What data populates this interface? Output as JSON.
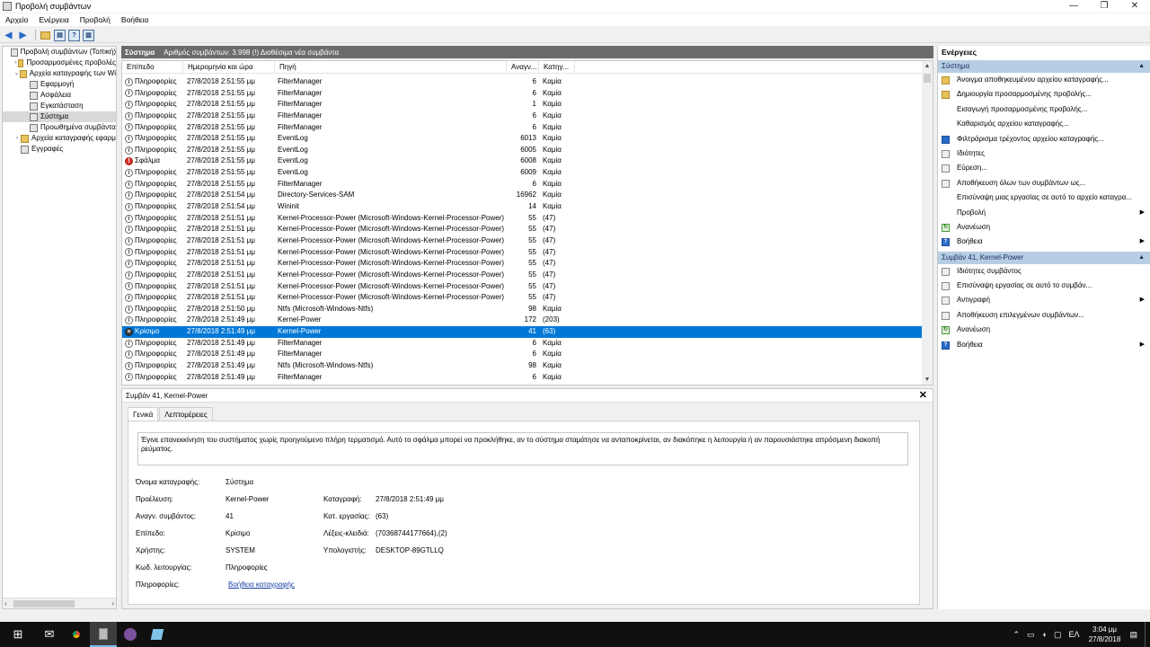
{
  "window": {
    "title": "Προβολή συμβάντων",
    "controls": [
      "—",
      "❐",
      "✕"
    ]
  },
  "menu": [
    "Αρχείο",
    "Ενέργεια",
    "Προβολή",
    "Βοήθεια"
  ],
  "tree": [
    {
      "label": "Προβολή συμβάντων (Τοπική)",
      "indent": 0,
      "exp": "",
      "icon": "eventviewer-icon"
    },
    {
      "label": "Προσαρμοσμένες προβολές",
      "indent": 1,
      "exp": "›",
      "icon": "folder-icon"
    },
    {
      "label": "Αρχεία καταγραφής των Wi",
      "indent": 1,
      "exp": "⌄",
      "icon": "folder-icon"
    },
    {
      "label": "Εφαρμογή",
      "indent": 2,
      "exp": "",
      "icon": "log-icon"
    },
    {
      "label": "Ασφάλεια",
      "indent": 2,
      "exp": "",
      "icon": "log-icon"
    },
    {
      "label": "Εγκατάσταση",
      "indent": 2,
      "exp": "",
      "icon": "log-icon"
    },
    {
      "label": "Σύστημα",
      "indent": 2,
      "exp": "",
      "icon": "log-icon",
      "selected": true
    },
    {
      "label": "Προωθημένα συμβάντα",
      "indent": 2,
      "exp": "",
      "icon": "log-icon"
    },
    {
      "label": "Αρχεία καταγραφής εφαρμ",
      "indent": 1,
      "exp": "›",
      "icon": "folder-icon"
    },
    {
      "label": "Εγγραφές",
      "indent": 1,
      "exp": "",
      "icon": "subscriptions-icon"
    }
  ],
  "center_header": {
    "log_name": "Σύστημα",
    "summary": "Αριθμός συμβάντων: 3.998 (!) Διαθέσιμα νέα συμβάντα"
  },
  "columns": [
    "Επίπεδο",
    "Ημερομηνία και ώρα",
    "Πηγή",
    "Αναγν...",
    "Κατηγ..."
  ],
  "events": [
    {
      "level": "Πληροφορίες",
      "type": "info",
      "date": "27/8/2018 2:51:55 μμ",
      "source": "FilterManager",
      "id": "6",
      "cat": "Καμία"
    },
    {
      "level": "Πληροφορίες",
      "type": "info",
      "date": "27/8/2018 2:51:55 μμ",
      "source": "FilterManager",
      "id": "6",
      "cat": "Καμία"
    },
    {
      "level": "Πληροφορίες",
      "type": "info",
      "date": "27/8/2018 2:51:55 μμ",
      "source": "FilterManager",
      "id": "1",
      "cat": "Καμία"
    },
    {
      "level": "Πληροφορίες",
      "type": "info",
      "date": "27/8/2018 2:51:55 μμ",
      "source": "FilterManager",
      "id": "6",
      "cat": "Καμία"
    },
    {
      "level": "Πληροφορίες",
      "type": "info",
      "date": "27/8/2018 2:51:55 μμ",
      "source": "FilterManager",
      "id": "6",
      "cat": "Καμία"
    },
    {
      "level": "Πληροφορίες",
      "type": "info",
      "date": "27/8/2018 2:51:55 μμ",
      "source": "EventLog",
      "id": "6013",
      "cat": "Καμία"
    },
    {
      "level": "Πληροφορίες",
      "type": "info",
      "date": "27/8/2018 2:51:55 μμ",
      "source": "EventLog",
      "id": "6005",
      "cat": "Καμία"
    },
    {
      "level": "Σφάλμα",
      "type": "error",
      "date": "27/8/2018 2:51:55 μμ",
      "source": "EventLog",
      "id": "6008",
      "cat": "Καμία"
    },
    {
      "level": "Πληροφορίες",
      "type": "info",
      "date": "27/8/2018 2:51:55 μμ",
      "source": "EventLog",
      "id": "6009",
      "cat": "Καμία"
    },
    {
      "level": "Πληροφορίες",
      "type": "info",
      "date": "27/8/2018 2:51:55 μμ",
      "source": "FilterManager",
      "id": "6",
      "cat": "Καμία"
    },
    {
      "level": "Πληροφορίες",
      "type": "info",
      "date": "27/8/2018 2:51:54 μμ",
      "source": "Directory-Services-SAM",
      "id": "16962",
      "cat": "Καμία"
    },
    {
      "level": "Πληροφορίες",
      "type": "info",
      "date": "27/8/2018 2:51:54 μμ",
      "source": "Wininit",
      "id": "14",
      "cat": "Καμία"
    },
    {
      "level": "Πληροφορίες",
      "type": "info",
      "date": "27/8/2018 2:51:51 μμ",
      "source": "Kernel-Processor-Power (Microsoft-Windows-Kernel-Processor-Power)",
      "id": "55",
      "cat": "(47)"
    },
    {
      "level": "Πληροφορίες",
      "type": "info",
      "date": "27/8/2018 2:51:51 μμ",
      "source": "Kernel-Processor-Power (Microsoft-Windows-Kernel-Processor-Power)",
      "id": "55",
      "cat": "(47)"
    },
    {
      "level": "Πληροφορίες",
      "type": "info",
      "date": "27/8/2018 2:51:51 μμ",
      "source": "Kernel-Processor-Power (Microsoft-Windows-Kernel-Processor-Power)",
      "id": "55",
      "cat": "(47)"
    },
    {
      "level": "Πληροφορίες",
      "type": "info",
      "date": "27/8/2018 2:51:51 μμ",
      "source": "Kernel-Processor-Power (Microsoft-Windows-Kernel-Processor-Power)",
      "id": "55",
      "cat": "(47)"
    },
    {
      "level": "Πληροφορίες",
      "type": "info",
      "date": "27/8/2018 2:51:51 μμ",
      "source": "Kernel-Processor-Power (Microsoft-Windows-Kernel-Processor-Power)",
      "id": "55",
      "cat": "(47)"
    },
    {
      "level": "Πληροφορίες",
      "type": "info",
      "date": "27/8/2018 2:51:51 μμ",
      "source": "Kernel-Processor-Power (Microsoft-Windows-Kernel-Processor-Power)",
      "id": "55",
      "cat": "(47)"
    },
    {
      "level": "Πληροφορίες",
      "type": "info",
      "date": "27/8/2018 2:51:51 μμ",
      "source": "Kernel-Processor-Power (Microsoft-Windows-Kernel-Processor-Power)",
      "id": "55",
      "cat": "(47)"
    },
    {
      "level": "Πληροφορίες",
      "type": "info",
      "date": "27/8/2018 2:51:51 μμ",
      "source": "Kernel-Processor-Power (Microsoft-Windows-Kernel-Processor-Power)",
      "id": "55",
      "cat": "(47)"
    },
    {
      "level": "Πληροφορίες",
      "type": "info",
      "date": "27/8/2018 2:51:50 μμ",
      "source": "Ntfs (Microsoft-Windows-Ntfs)",
      "id": "98",
      "cat": "Καμία"
    },
    {
      "level": "Πληροφορίες",
      "type": "info",
      "date": "27/8/2018 2:51:49 μμ",
      "source": "Kernel-Power",
      "id": "172",
      "cat": "(203)"
    },
    {
      "level": "Κρίσιμο",
      "type": "critical",
      "date": "27/8/2018 2:51:49 μμ",
      "source": "Kernel-Power",
      "id": "41",
      "cat": "(63)",
      "selected": true
    },
    {
      "level": "Πληροφορίες",
      "type": "info",
      "date": "27/8/2018 2:51:49 μμ",
      "source": "FilterManager",
      "id": "6",
      "cat": "Καμία"
    },
    {
      "level": "Πληροφορίες",
      "type": "info",
      "date": "27/8/2018 2:51:49 μμ",
      "source": "FilterManager",
      "id": "6",
      "cat": "Καμία"
    },
    {
      "level": "Πληροφορίες",
      "type": "info",
      "date": "27/8/2018 2:51:49 μμ",
      "source": "Ntfs (Microsoft-Windows-Ntfs)",
      "id": "98",
      "cat": "Καμία"
    },
    {
      "level": "Πληροφορίες",
      "type": "info",
      "date": "27/8/2018 2:51:49 μμ",
      "source": "FilterManager",
      "id": "6",
      "cat": "Καμία"
    }
  ],
  "detail": {
    "title": "Συμβάν 41, Kernel-Power",
    "tabs": [
      "Γενικά",
      "Λεπτομέρειες"
    ],
    "description": "Έγινε επανεκκίνηση του συστήματος χωρίς προηγούμενο πλήρη τερματισμό. Αυτό το σφάλμα μπορεί να προκλήθηκε, αν το σύστημα σταμάτησε να ανταποκρίνεται, αν διακόπηκε η λειτουργία ή αν παρουσιάστηκε απρόσμενη διακοπή ρεύματος.",
    "fields": {
      "log_name_label": "Όνομα καταγραφής:",
      "log_name": "Σύστημα",
      "source_label": "Προέλευση:",
      "source": "Kernel-Power",
      "logged_label": "Καταγραφή:",
      "logged": "27/8/2018 2:51:49 μμ",
      "event_id_label": "Αναγν. συμβάντος:",
      "event_id": "41",
      "task_label": "Κατ. εργασίας:",
      "task": "(63)",
      "level_label": "Επίπεδο:",
      "level": "Κρίσιμο",
      "keywords_label": "Λέξεις-κλειδιά:",
      "keywords": "(70368744177664),(2)",
      "user_label": "Χρήστης:",
      "user": "SYSTEM",
      "computer_label": "Υπολογιστής:",
      "computer": "DESKTOP-89GTLLQ",
      "opcode_label": "Κωδ. λειτουργίας:",
      "opcode": "Πληροφορίες",
      "info_label": "Πληροφορίες:",
      "info_link": "Βοήθεια καταγραφής"
    }
  },
  "actions": {
    "title": "Ενέργειες",
    "section1": "Σύστημα",
    "section1_items": [
      {
        "label": "Άνοιγμα αποθηκευμένου αρχείου καταγραφής...",
        "icon": "open-log-icon",
        "style": "gold"
      },
      {
        "label": "Δημιουργία προσαρμοσμένης προβολής...",
        "icon": "create-view-icon",
        "style": "gold"
      },
      {
        "label": "Εισαγωγή προσαρμοσμένης προβολής...",
        "icon": "",
        "style": ""
      },
      {
        "label": "Καθαρισμός αρχείου καταγραφής...",
        "icon": "",
        "style": ""
      },
      {
        "label": "Φιλτράρισμα τρέχοντος αρχείου καταγραφής...",
        "icon": "filter-icon",
        "style": "blue"
      },
      {
        "label": "Ιδιότητες",
        "icon": "properties-icon",
        "style": ""
      },
      {
        "label": "Εύρεση...",
        "icon": "find-icon",
        "style": ""
      },
      {
        "label": "Αποθήκευση όλων των συμβάντων ως...",
        "icon": "save-icon",
        "style": ""
      },
      {
        "label": "Επισύναψη μιας εργασίας σε αυτό το αρχείο καταγρα...",
        "icon": "",
        "style": ""
      },
      {
        "label": "Προβολή",
        "icon": "",
        "style": "",
        "submenu": true
      },
      {
        "label": "Ανανέωση",
        "icon": "refresh-icon",
        "style": "green"
      },
      {
        "label": "Βοήθεια",
        "icon": "help-icon",
        "style": "blue",
        "submenu": true
      }
    ],
    "section2": "Συμβάν 41, Kernel-Power",
    "section2_items": [
      {
        "label": "Ιδιότητες συμβάντος",
        "icon": "event-properties-icon",
        "style": ""
      },
      {
        "label": "Επισύναψη εργασίας σε αυτό το συμβάν...",
        "icon": "attach-task-icon",
        "style": ""
      },
      {
        "label": "Αντιγραφή",
        "icon": "copy-icon",
        "style": "",
        "submenu": true
      },
      {
        "label": "Αποθήκευση επιλεγμένων συμβάντων...",
        "icon": "save-icon",
        "style": ""
      },
      {
        "label": "Ανανέωση",
        "icon": "refresh-icon",
        "style": "green"
      },
      {
        "label": "Βοήθεια",
        "icon": "help-icon",
        "style": "blue",
        "submenu": true
      }
    ]
  },
  "taskbar": {
    "lang": "ΕΛ",
    "time": "3:04 μμ",
    "date": "27/8/2018"
  }
}
